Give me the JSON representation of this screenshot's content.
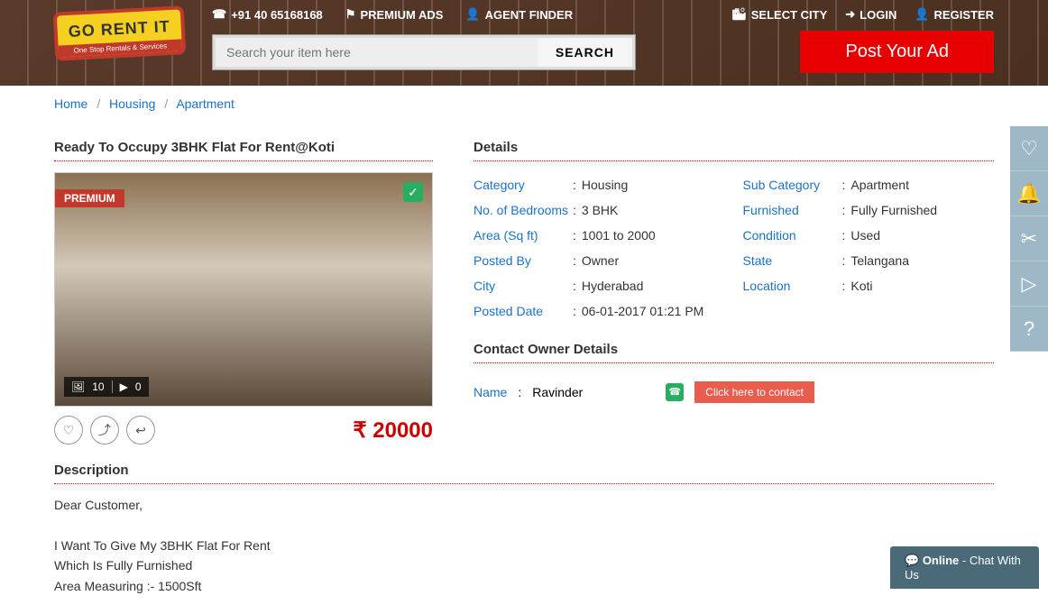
{
  "header": {
    "logo_text": "GO RENT IT",
    "logo_subtitle": "One Stop Rentals & Services",
    "phone": "+91 40 65168168",
    "premium_ads": "PREMIUM ADS",
    "agent_finder": "AGENT FINDER",
    "select_city": "SELECT CITY",
    "login": "LOGIN",
    "register": "REGISTER",
    "search_placeholder": "Search your item here",
    "search_button": "SEARCH",
    "post_ad": "Post Your Ad"
  },
  "breadcrumb": {
    "home": "Home",
    "housing": "Housing",
    "apartment": "Apartment"
  },
  "listing": {
    "title": "Ready To Occupy 3BHK Flat For Rent@Koti",
    "premium_label": "PREMIUM",
    "photo_count": "10",
    "video_count": "0",
    "price": "₹ 20000"
  },
  "details": {
    "title": "Details",
    "rows": {
      "category": {
        "label": "Category",
        "value": "Housing"
      },
      "sub_category": {
        "label": "Sub Category",
        "value": "Apartment"
      },
      "bedrooms": {
        "label": "No. of Bedrooms",
        "value": "3 BHK"
      },
      "furnished": {
        "label": "Furnished",
        "value": "Fully Furnished"
      },
      "area": {
        "label": "Area (Sq ft)",
        "value": "1001 to 2000"
      },
      "condition": {
        "label": "Condition",
        "value": "Used"
      },
      "posted_by": {
        "label": "Posted By",
        "value": "Owner"
      },
      "state": {
        "label": "State",
        "value": "Telangana"
      },
      "city": {
        "label": "City",
        "value": "Hyderabad"
      },
      "location": {
        "label": "Location",
        "value": "Koti"
      },
      "posted_date": {
        "label": "Posted Date",
        "value": "06-01-2017 01:21 PM"
      }
    }
  },
  "contact": {
    "title": "Contact Owner Details",
    "name_label": "Name",
    "name_value": "Ravinder",
    "contact_button": "Click here to contact"
  },
  "description": {
    "title": "Description",
    "line1": "Dear Customer,",
    "line2": "I Want To Give My 3BHK Flat For Rent",
    "line3": "Which Is Fully Furnished",
    "line4": "Area Measuring :- 1500Sft"
  },
  "chat": {
    "status": "Online",
    "text": " - Chat With Us"
  }
}
